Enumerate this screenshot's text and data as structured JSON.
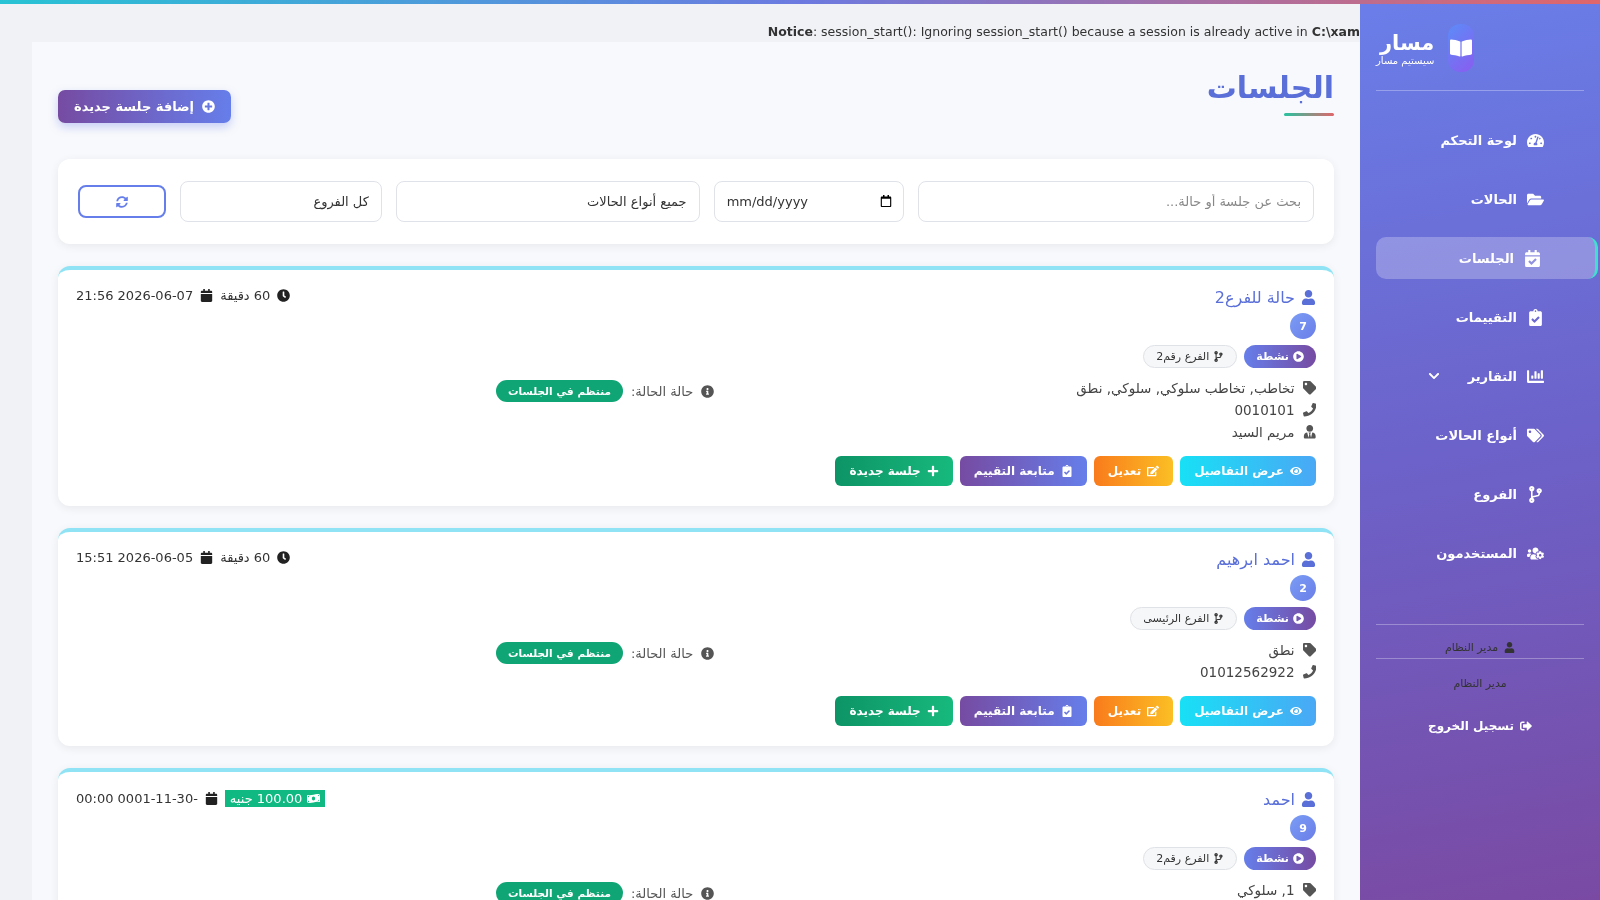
{
  "notice": "**Notice**: session_start(): Ignoring session_start() because a session is already active in **C:\\xam**",
  "page": {
    "title": "الجلسات",
    "add_button": "إضافة جلسة جديدة"
  },
  "filters": {
    "search": {
      "placeholder": "بحث عن جلسة أو حالة..."
    },
    "date": {
      "placeholder": "mm/dd/yyyy"
    },
    "case_type": {
      "value": "جميع أنواع الحالات"
    },
    "branch": {
      "value": "كل الفروع"
    }
  },
  "sessions": [
    {
      "name": "حالة للفرع2",
      "count": "7",
      "status": "نشطة",
      "branch": "الفرع رقم2",
      "meta": {
        "kind": "duration",
        "text": "60 دقيقة"
      },
      "date": "21:56 2026-06-07",
      "status_label": "حالة الحالة:",
      "status_value": "منتظم في الجلسات",
      "info": [
        {
          "kind": "tag",
          "text": "تخاطب, تخاطب سلوكي, سلوكي, نطق"
        },
        {
          "kind": "phone",
          "text": "0010101"
        },
        {
          "kind": "person",
          "text": "مريم السيد"
        }
      ],
      "actions": [
        {
          "kind": "view",
          "label": "عرض التفاصيل"
        },
        {
          "kind": "edit",
          "label": "تعديل"
        },
        {
          "kind": "assess",
          "label": "متابعة التقييم"
        },
        {
          "kind": "new",
          "label": "جلسة جديدة"
        }
      ]
    },
    {
      "name": "احمد ابرهيم",
      "count": "2",
      "status": "نشطة",
      "branch": "الفرع الرئيسى",
      "meta": {
        "kind": "duration",
        "text": "60 دقيقة"
      },
      "date": "15:51 2026-06-05",
      "status_label": "حالة الحالة:",
      "status_value": "منتظم في الجلسات",
      "info": [
        {
          "kind": "tag",
          "text": "نطق"
        },
        {
          "kind": "phone",
          "text": "01012562922"
        }
      ],
      "actions": [
        {
          "kind": "view",
          "label": "عرض التفاصيل"
        },
        {
          "kind": "edit",
          "label": "تعديل"
        },
        {
          "kind": "assess",
          "label": "متابعة التقييم"
        },
        {
          "kind": "new",
          "label": "جلسة جديدة"
        }
      ]
    },
    {
      "name": "احمد",
      "count": "9",
      "status": "نشطة",
      "branch": "الفرع رقم2",
      "meta": {
        "kind": "price",
        "text": "100.00 جنيه"
      },
      "date": "00:00 0001-11-30-",
      "status_label": "حالة الحالة:",
      "status_value": "منتظم في الجلسات",
      "info": [
        {
          "kind": "tag",
          "text": "1, سلوكي"
        }
      ]
    }
  ],
  "sidebar": {
    "title": "مسار",
    "subtitle": "سيستيم مسار",
    "items": [
      {
        "kind": "dashboard",
        "label": "لوحة التحكم",
        "selected": false
      },
      {
        "kind": "cases",
        "label": "الحالات",
        "selected": false
      },
      {
        "kind": "sessions",
        "label": "الجلسات",
        "selected": true
      },
      {
        "kind": "assessments",
        "label": "التقييمات",
        "selected": false
      },
      {
        "kind": "reports",
        "label": "التقارير",
        "selected": false,
        "expanded": false
      },
      {
        "kind": "types",
        "label": "أنواع الحالات",
        "selected": false
      },
      {
        "kind": "branches",
        "label": "الفروع",
        "selected": false
      },
      {
        "kind": "users",
        "label": "المستخدمون",
        "selected": false
      }
    ],
    "user": {
      "name": "مدير النظام",
      "role": "مدير النظام"
    },
    "logout": "تسجيل الخروج"
  }
}
